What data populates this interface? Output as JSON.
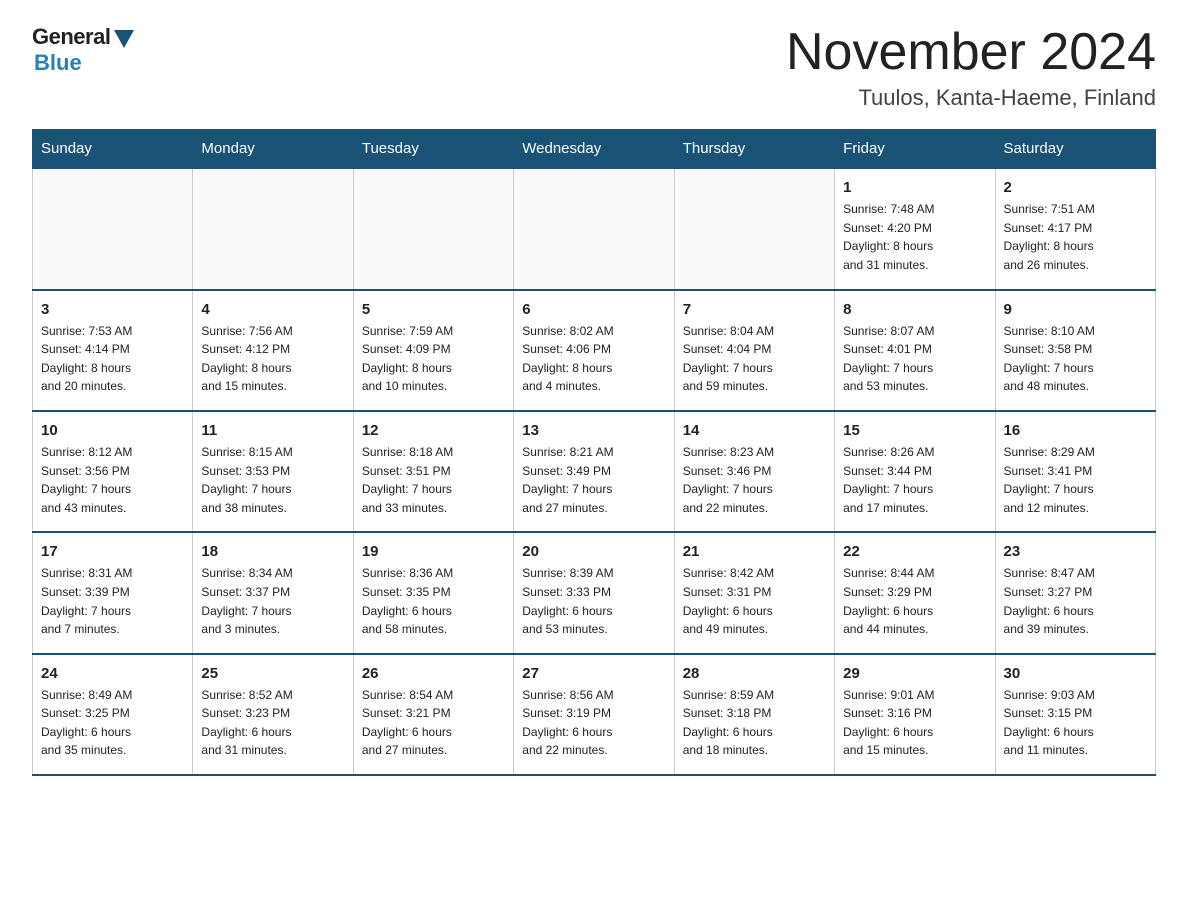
{
  "logo": {
    "top": "General",
    "arrow": "",
    "bottom": "Blue"
  },
  "header": {
    "month": "November 2024",
    "location": "Tuulos, Kanta-Haeme, Finland"
  },
  "weekdays": [
    "Sunday",
    "Monday",
    "Tuesday",
    "Wednesday",
    "Thursday",
    "Friday",
    "Saturday"
  ],
  "weeks": [
    [
      {
        "day": "",
        "info": ""
      },
      {
        "day": "",
        "info": ""
      },
      {
        "day": "",
        "info": ""
      },
      {
        "day": "",
        "info": ""
      },
      {
        "day": "",
        "info": ""
      },
      {
        "day": "1",
        "info": "Sunrise: 7:48 AM\nSunset: 4:20 PM\nDaylight: 8 hours\nand 31 minutes."
      },
      {
        "day": "2",
        "info": "Sunrise: 7:51 AM\nSunset: 4:17 PM\nDaylight: 8 hours\nand 26 minutes."
      }
    ],
    [
      {
        "day": "3",
        "info": "Sunrise: 7:53 AM\nSunset: 4:14 PM\nDaylight: 8 hours\nand 20 minutes."
      },
      {
        "day": "4",
        "info": "Sunrise: 7:56 AM\nSunset: 4:12 PM\nDaylight: 8 hours\nand 15 minutes."
      },
      {
        "day": "5",
        "info": "Sunrise: 7:59 AM\nSunset: 4:09 PM\nDaylight: 8 hours\nand 10 minutes."
      },
      {
        "day": "6",
        "info": "Sunrise: 8:02 AM\nSunset: 4:06 PM\nDaylight: 8 hours\nand 4 minutes."
      },
      {
        "day": "7",
        "info": "Sunrise: 8:04 AM\nSunset: 4:04 PM\nDaylight: 7 hours\nand 59 minutes."
      },
      {
        "day": "8",
        "info": "Sunrise: 8:07 AM\nSunset: 4:01 PM\nDaylight: 7 hours\nand 53 minutes."
      },
      {
        "day": "9",
        "info": "Sunrise: 8:10 AM\nSunset: 3:58 PM\nDaylight: 7 hours\nand 48 minutes."
      }
    ],
    [
      {
        "day": "10",
        "info": "Sunrise: 8:12 AM\nSunset: 3:56 PM\nDaylight: 7 hours\nand 43 minutes."
      },
      {
        "day": "11",
        "info": "Sunrise: 8:15 AM\nSunset: 3:53 PM\nDaylight: 7 hours\nand 38 minutes."
      },
      {
        "day": "12",
        "info": "Sunrise: 8:18 AM\nSunset: 3:51 PM\nDaylight: 7 hours\nand 33 minutes."
      },
      {
        "day": "13",
        "info": "Sunrise: 8:21 AM\nSunset: 3:49 PM\nDaylight: 7 hours\nand 27 minutes."
      },
      {
        "day": "14",
        "info": "Sunrise: 8:23 AM\nSunset: 3:46 PM\nDaylight: 7 hours\nand 22 minutes."
      },
      {
        "day": "15",
        "info": "Sunrise: 8:26 AM\nSunset: 3:44 PM\nDaylight: 7 hours\nand 17 minutes."
      },
      {
        "day": "16",
        "info": "Sunrise: 8:29 AM\nSunset: 3:41 PM\nDaylight: 7 hours\nand 12 minutes."
      }
    ],
    [
      {
        "day": "17",
        "info": "Sunrise: 8:31 AM\nSunset: 3:39 PM\nDaylight: 7 hours\nand 7 minutes."
      },
      {
        "day": "18",
        "info": "Sunrise: 8:34 AM\nSunset: 3:37 PM\nDaylight: 7 hours\nand 3 minutes."
      },
      {
        "day": "19",
        "info": "Sunrise: 8:36 AM\nSunset: 3:35 PM\nDaylight: 6 hours\nand 58 minutes."
      },
      {
        "day": "20",
        "info": "Sunrise: 8:39 AM\nSunset: 3:33 PM\nDaylight: 6 hours\nand 53 minutes."
      },
      {
        "day": "21",
        "info": "Sunrise: 8:42 AM\nSunset: 3:31 PM\nDaylight: 6 hours\nand 49 minutes."
      },
      {
        "day": "22",
        "info": "Sunrise: 8:44 AM\nSunset: 3:29 PM\nDaylight: 6 hours\nand 44 minutes."
      },
      {
        "day": "23",
        "info": "Sunrise: 8:47 AM\nSunset: 3:27 PM\nDaylight: 6 hours\nand 39 minutes."
      }
    ],
    [
      {
        "day": "24",
        "info": "Sunrise: 8:49 AM\nSunset: 3:25 PM\nDaylight: 6 hours\nand 35 minutes."
      },
      {
        "day": "25",
        "info": "Sunrise: 8:52 AM\nSunset: 3:23 PM\nDaylight: 6 hours\nand 31 minutes."
      },
      {
        "day": "26",
        "info": "Sunrise: 8:54 AM\nSunset: 3:21 PM\nDaylight: 6 hours\nand 27 minutes."
      },
      {
        "day": "27",
        "info": "Sunrise: 8:56 AM\nSunset: 3:19 PM\nDaylight: 6 hours\nand 22 minutes."
      },
      {
        "day": "28",
        "info": "Sunrise: 8:59 AM\nSunset: 3:18 PM\nDaylight: 6 hours\nand 18 minutes."
      },
      {
        "day": "29",
        "info": "Sunrise: 9:01 AM\nSunset: 3:16 PM\nDaylight: 6 hours\nand 15 minutes."
      },
      {
        "day": "30",
        "info": "Sunrise: 9:03 AM\nSunset: 3:15 PM\nDaylight: 6 hours\nand 11 minutes."
      }
    ]
  ]
}
